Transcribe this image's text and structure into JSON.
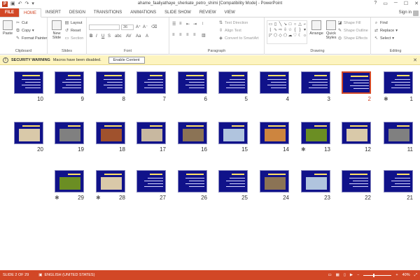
{
  "window": {
    "title": "ahame_faaliyathaye_sherkate_petro_shimi [Compatibility Mode] - PowerPoint",
    "sign_in": "Sign in",
    "app_badge": "P"
  },
  "tabs": [
    "FILE",
    "HOME",
    "INSERT",
    "DESIGN",
    "TRANSITIONS",
    "ANIMATIONS",
    "SLIDE SHOW",
    "REVIEW",
    "VIEW"
  ],
  "active_tab": "HOME",
  "ribbon": {
    "clipboard": {
      "label": "Clipboard",
      "paste": "Paste",
      "cut": "Cut",
      "copy": "Copy",
      "format_painter": "Format Painter"
    },
    "slides": {
      "label": "Slides",
      "new_slide": "New Slide",
      "layout": "Layout",
      "reset": "Reset",
      "section": "Section"
    },
    "font": {
      "label": "Font",
      "font_size": "36"
    },
    "paragraph": {
      "label": "Paragraph",
      "text_direction": "Text Direction",
      "align_text": "Align Text",
      "convert": "Convert to SmartArt"
    },
    "drawing": {
      "label": "Drawing",
      "arrange": "Arrange",
      "quick_styles": "Quick Styles",
      "shape_fill": "Shape Fill",
      "shape_outline": "Shape Outline",
      "shape_effects": "Shape Effects"
    },
    "editing": {
      "label": "Editing",
      "find": "Find",
      "replace": "Replace",
      "select": "Select"
    }
  },
  "security_bar": {
    "label": "SECURITY WARNING",
    "message": "Macros have been disabled.",
    "button": "Enable Content"
  },
  "slides": [
    {
      "num": "1",
      "star": true
    },
    {
      "num": "2",
      "selected": true
    },
    {
      "num": "3"
    },
    {
      "num": "4"
    },
    {
      "num": "5"
    },
    {
      "num": "6"
    },
    {
      "num": "7"
    },
    {
      "num": "8"
    },
    {
      "num": "9"
    },
    {
      "num": "10"
    },
    {
      "num": "11"
    },
    {
      "num": "12"
    },
    {
      "num": "13",
      "star": true
    },
    {
      "num": "14"
    },
    {
      "num": "15"
    },
    {
      "num": "16"
    },
    {
      "num": "17"
    },
    {
      "num": "18"
    },
    {
      "num": "19"
    },
    {
      "num": "20"
    },
    {
      "num": "21"
    },
    {
      "num": "22"
    },
    {
      "num": "23"
    },
    {
      "num": "24"
    },
    {
      "num": "25"
    },
    {
      "num": "26"
    },
    {
      "num": "27"
    },
    {
      "num": "28",
      "star": true
    },
    {
      "num": "29",
      "star": true
    }
  ],
  "status_bar": {
    "slide_info": "SLIDE 2 OF 29",
    "language": "ENGLISH (UNITED STATES)",
    "zoom": "40%"
  },
  "icons": {
    "undo": "↶",
    "redo": "↷",
    "close": "✕",
    "minimize": "─",
    "maximize": "☐",
    "help": "?"
  },
  "colors": {
    "accent": "#d24726",
    "slide_bg": "#10128a",
    "warning_bg": "#fdf4bf"
  }
}
